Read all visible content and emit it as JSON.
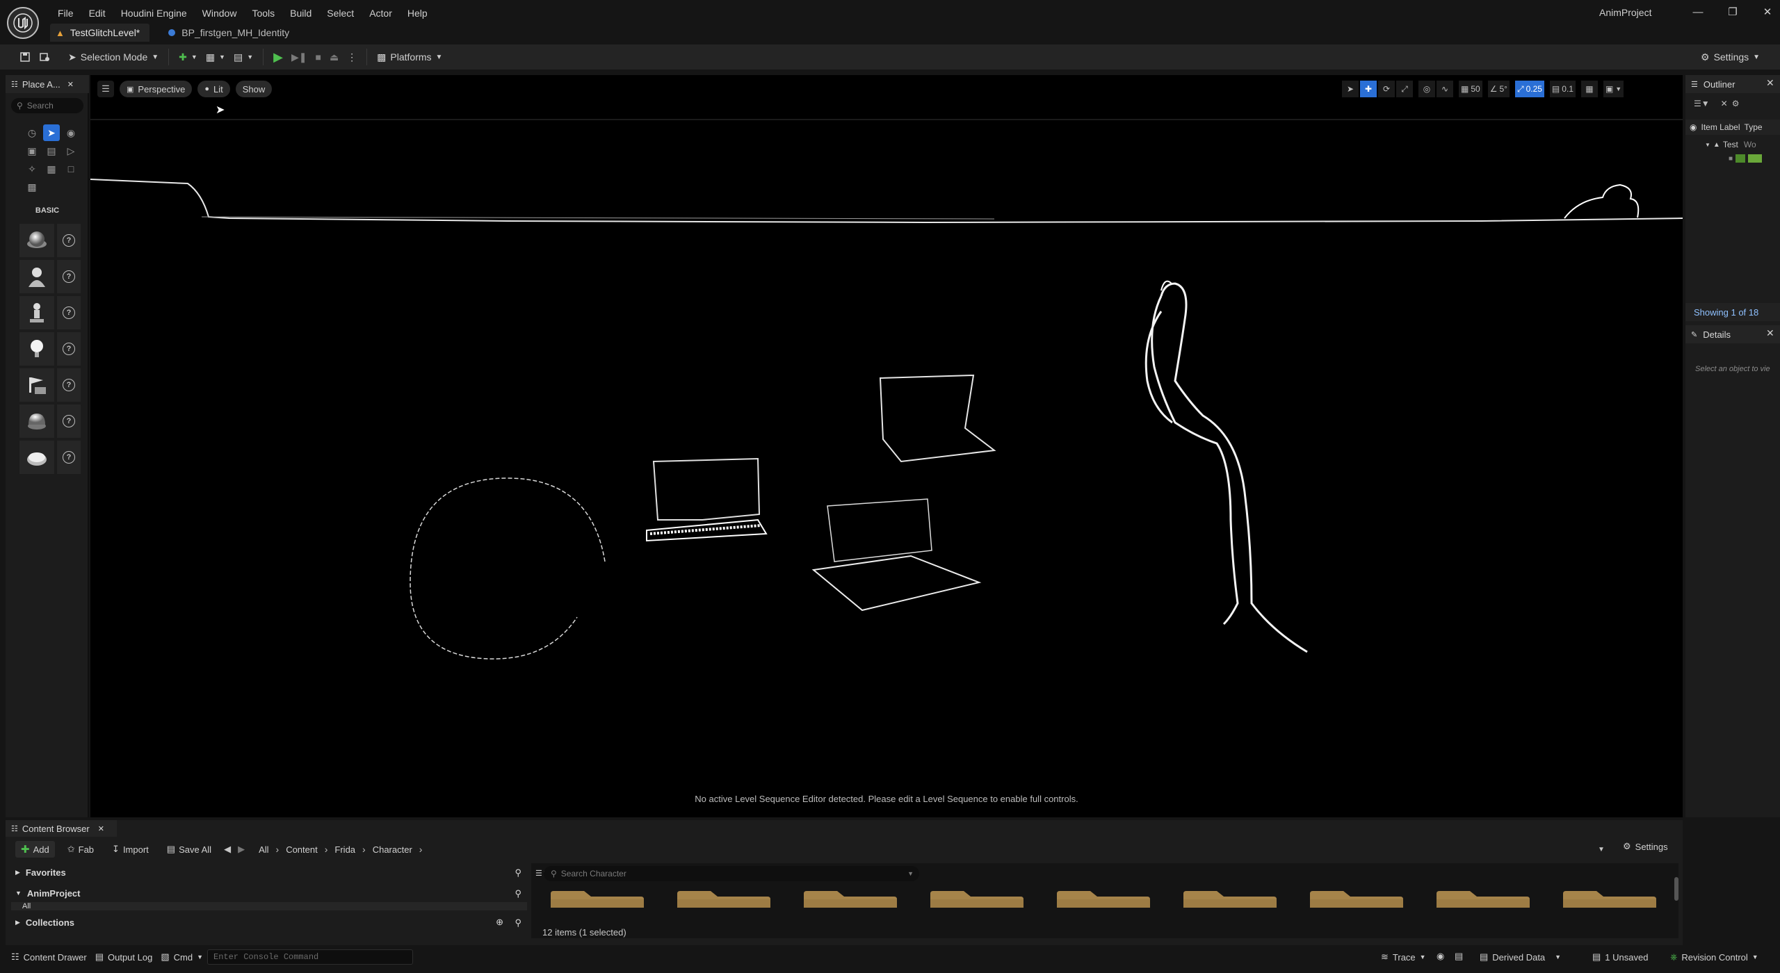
{
  "app": {
    "project_name": "AnimProject",
    "menu": [
      "File",
      "Edit",
      "Houdini Engine",
      "Window",
      "Tools",
      "Build",
      "Select",
      "Actor",
      "Help"
    ],
    "tabs": [
      {
        "label": "TestGlitchLevel*",
        "active": true
      },
      {
        "label": "BP_firstgen_MH_Identity",
        "active": false
      }
    ]
  },
  "toolbar": {
    "mode_label": "Selection Mode",
    "platforms_label": "Platforms",
    "settings_label": "Settings"
  },
  "place_actors": {
    "tab_label": "Place A...",
    "search_placeholder": "Search",
    "category_label": "BASIC",
    "actors": [
      "sphere-actor",
      "character-actor",
      "pawn-actor",
      "point-light-actor",
      "player-start-actor",
      "cube-actor",
      "plane-actor"
    ]
  },
  "viewport": {
    "perspective_label": "Perspective",
    "lit_label": "Lit",
    "show_label": "Show",
    "grid_snap": "50",
    "rotation_snap": "5°",
    "scale_snap": "0.25",
    "camera_speed": "0.1",
    "message": "No active Level Sequence Editor detected. Please edit a Level Sequence to enable full controls."
  },
  "outliner": {
    "tab_label": "Outliner",
    "column_label": "Item Label",
    "column_type": "Type",
    "root_label": "Test",
    "root_type": "Wo",
    "showing": "Showing 1 of 18"
  },
  "details": {
    "tab_label": "Details",
    "empty_text": "Select an object to vie"
  },
  "content_browser": {
    "tab_label": "Content Browser",
    "add_label": "Add",
    "fab_label": "Fab",
    "import_label": "Import",
    "save_all_label": "Save All",
    "breadcrumb": [
      "All",
      "Content",
      "Frida",
      "Character"
    ],
    "settings_label": "Settings",
    "favorites_label": "Favorites",
    "project_label": "AnimProject",
    "all_label": "All",
    "collections_label": "Collections",
    "search_placeholder": "Search Character",
    "items_count": "12 items (1 selected)",
    "folder_count": 9
  },
  "statusbar": {
    "content_drawer": "Content Drawer",
    "output_log": "Output Log",
    "cmd": "Cmd",
    "console_placeholder": "Enter Console Command",
    "trace": "Trace",
    "derived_data": "Derived Data",
    "unsaved": "1 Unsaved",
    "revision_control": "Revision Control"
  },
  "colors": {
    "accent_blue": "#2a6fd6",
    "play_green": "#4fbf4f",
    "folder_tan": "#a6844a",
    "showing_blue": "#8fc1ff"
  }
}
